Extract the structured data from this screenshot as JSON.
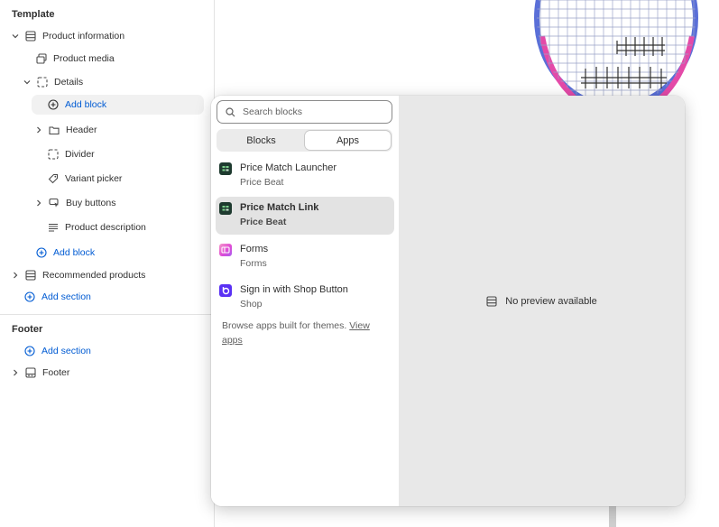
{
  "sidebar": {
    "template_title": "Template",
    "product_information": "Product information",
    "product_media": "Product media",
    "details": "Details",
    "add_block_1": "Add block",
    "header": "Header",
    "divider": "Divider",
    "variant_picker": "Variant picker",
    "buy_buttons": "Buy buttons",
    "product_description": "Product description",
    "add_block_2": "Add block",
    "recommended_products": "Recommended products",
    "add_section_1": "Add section",
    "footer_title": "Footer",
    "add_section_2": "Add section",
    "footer": "Footer"
  },
  "popover": {
    "search_placeholder": "Search blocks",
    "tabs": {
      "blocks": "Blocks",
      "apps": "Apps",
      "active": "Apps"
    },
    "apps": [
      {
        "name": "Price Match Launcher",
        "vendor": "Price Beat",
        "icon": "price-beat-icon",
        "color": "#1e3a2f"
      },
      {
        "name": "Price Match Link",
        "vendor": "Price Beat",
        "icon": "price-beat-icon",
        "color": "#1e3a2f",
        "selected": true
      },
      {
        "name": "Forms",
        "vendor": "Forms",
        "icon": "forms-icon",
        "color": "#e04bd5"
      },
      {
        "name": "Sign in with Shop Button",
        "vendor": "Shop",
        "icon": "shop-icon",
        "color": "#5a31f4"
      }
    ],
    "browse_text": "Browse apps built for themes. ",
    "browse_link": "View apps",
    "no_preview": "No preview available"
  },
  "colors": {
    "link": "#005bd3",
    "selected_bg": "#e3e3e3",
    "preview_bg": "#e8e8e8"
  }
}
